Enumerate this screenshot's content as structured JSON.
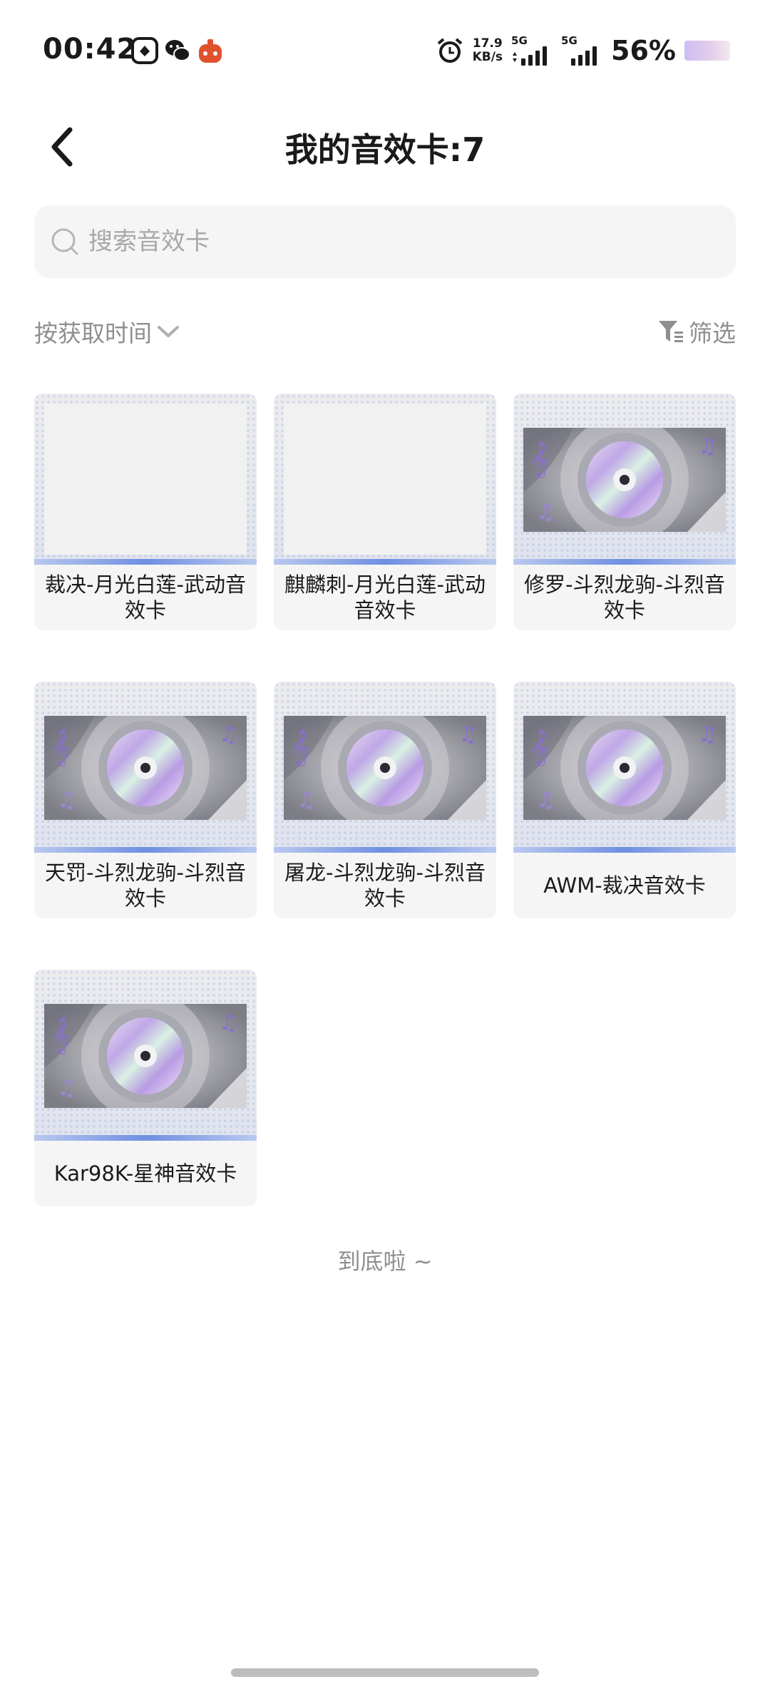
{
  "status_bar": {
    "time": "00:42",
    "network_speed_value": "17.9",
    "network_speed_unit": "KB/s",
    "sim1_label": "5G",
    "sim2_label": "5G",
    "battery_percent": "56%"
  },
  "header": {
    "title": "我的音效卡:7"
  },
  "search": {
    "placeholder": "搜索音效卡"
  },
  "sort": {
    "label": "按获取时间"
  },
  "filter": {
    "label": "筛选"
  },
  "cards": [
    {
      "name": "裁决-月光白莲-武动音效卡",
      "image": "blank"
    },
    {
      "name": "麒麟刺-月光白莲-武动音效卡",
      "image": "blank"
    },
    {
      "name": "修罗-斗烈龙驹-斗烈音效卡",
      "image": "music-disc"
    },
    {
      "name": "天罚-斗烈龙驹-斗烈音效卡",
      "image": "music-disc"
    },
    {
      "name": "屠龙-斗烈龙驹-斗烈音效卡",
      "image": "music-disc"
    },
    {
      "name": "AWM-裁决音效卡",
      "image": "music-disc"
    },
    {
      "name": "Kar98K-星神音效卡",
      "image": "music-disc"
    }
  ],
  "end_text": "到底啦 ~"
}
